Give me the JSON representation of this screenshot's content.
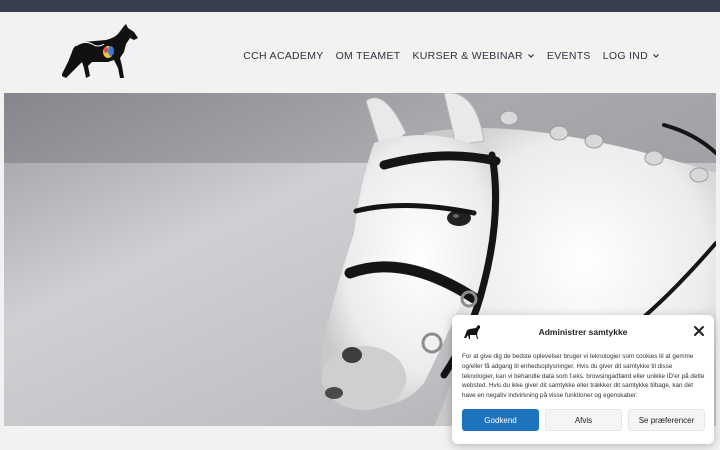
{
  "nav": {
    "items": [
      {
        "label": "CCH ACADEMY",
        "has_dropdown": false
      },
      {
        "label": "OM TEAMET",
        "has_dropdown": false
      },
      {
        "label": "KURSER & WEBINAR",
        "has_dropdown": true
      },
      {
        "label": "EVENTS",
        "has_dropdown": false
      },
      {
        "label": "LOG IND",
        "has_dropdown": true
      }
    ]
  },
  "logo": {
    "icon": "horse-logo-icon"
  },
  "hero": {
    "image": "white-horse-with-bridle"
  },
  "consent": {
    "title": "Administrer samtykke",
    "text": "For at give dig de bedste oplevelser bruger vi teknologier som cookies til at gemme og/eller få adgang til enhedsoplysninger. Hvis du giver dit samtykke til disse teknologier, kan vi behandle data som f.eks. browsingadfærd eller unikke ID'er på dette websted. Hvis du ikke giver dit samtykke eller trækker dit samtykke tilbage, kan det have en negativ indvirkning på visse funktioner og egenskaber.",
    "accept_label": "Godkend",
    "deny_label": "Afvis",
    "prefs_label": "Se præferencer"
  },
  "colors": {
    "topbar": "#3a3f4d",
    "background": "#f2f2f0",
    "accent": "#1e73be",
    "text": "#2f3340"
  }
}
